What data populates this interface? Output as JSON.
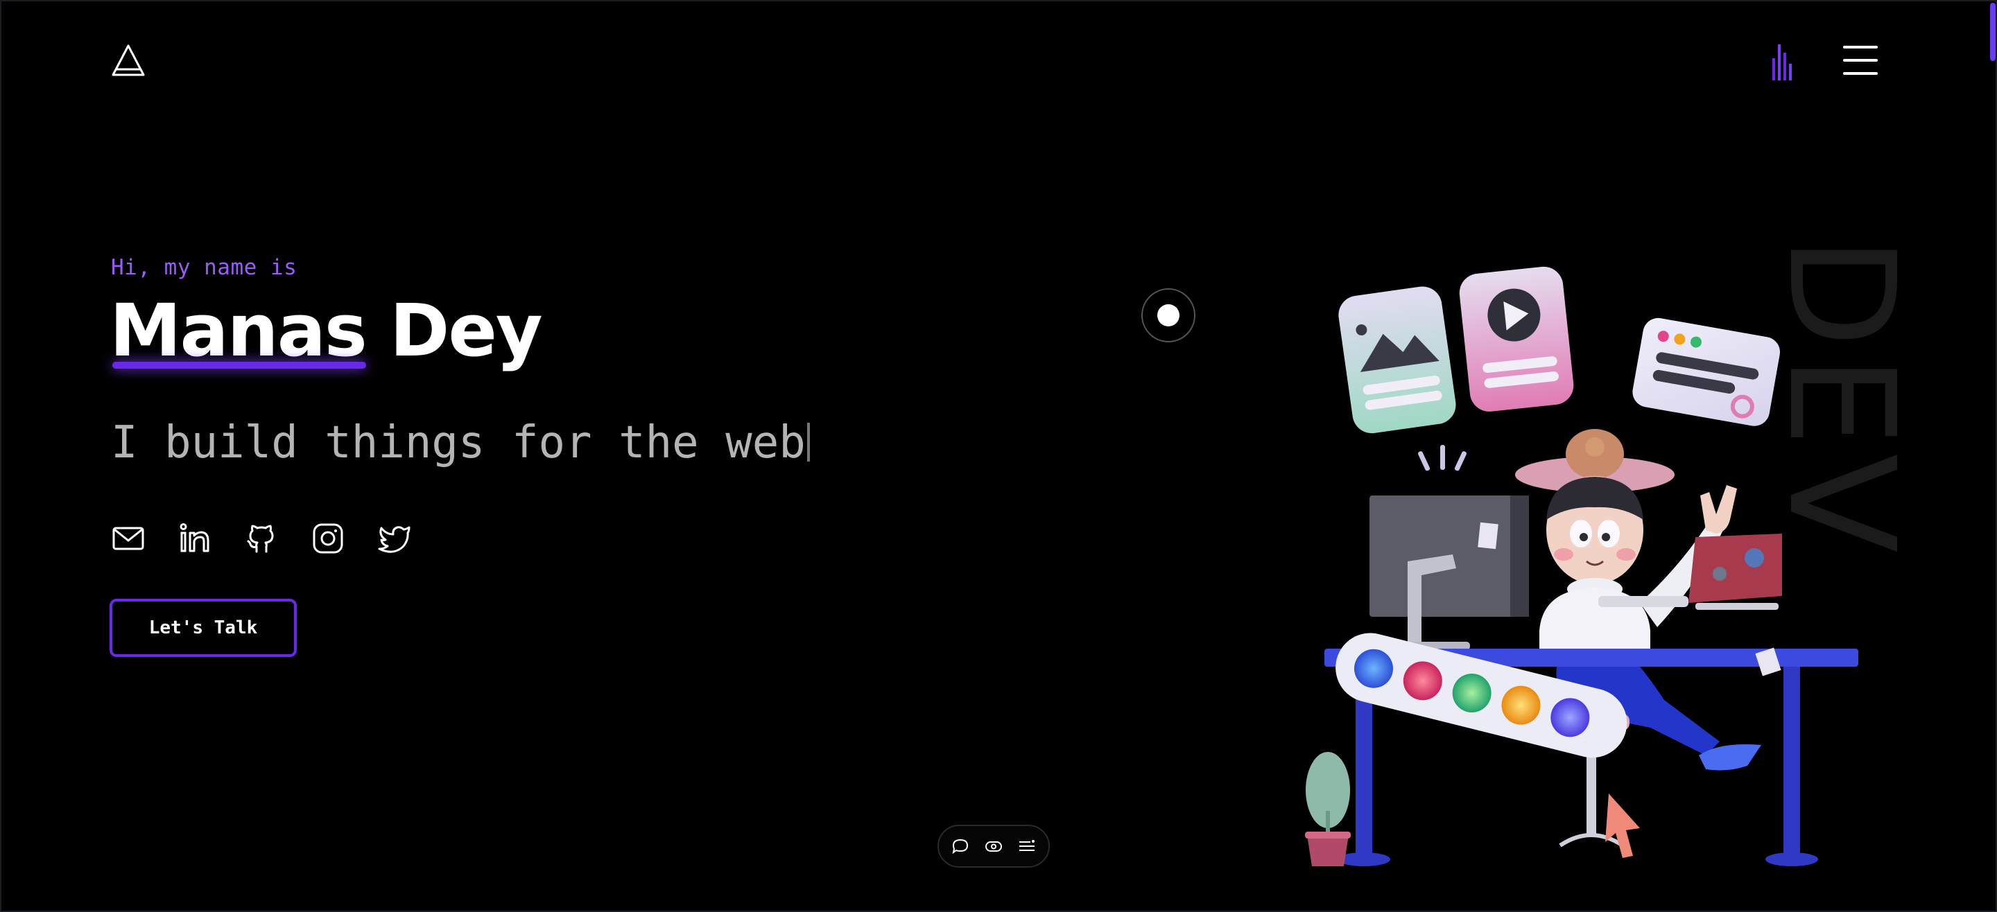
{
  "header": {
    "logo_icon": "triangle-logo-icon",
    "music_icon": "audio-bars-icon",
    "menu_icon": "hamburger-menu-icon",
    "accent_color": "#6a28e8"
  },
  "hero": {
    "greeting": "Hi, my name is",
    "name_first": "Manas",
    "name_last": "Dey",
    "tagline": "I build things for the web",
    "cta_label": "Let's Talk",
    "side_word": "DEV"
  },
  "socials": [
    {
      "icon": "mail-icon"
    },
    {
      "icon": "linkedin-icon"
    },
    {
      "icon": "github-icon"
    },
    {
      "icon": "instagram-icon"
    },
    {
      "icon": "twitter-icon"
    }
  ],
  "dock": [
    {
      "icon": "chat-bubble-icon"
    },
    {
      "icon": "eye-icon"
    },
    {
      "icon": "list-menu-icon"
    }
  ],
  "colors": {
    "background": "#000000",
    "greeting": "#9a5cf5",
    "tagline": "#b4b4b4",
    "cta_border": "#6a28e8"
  }
}
